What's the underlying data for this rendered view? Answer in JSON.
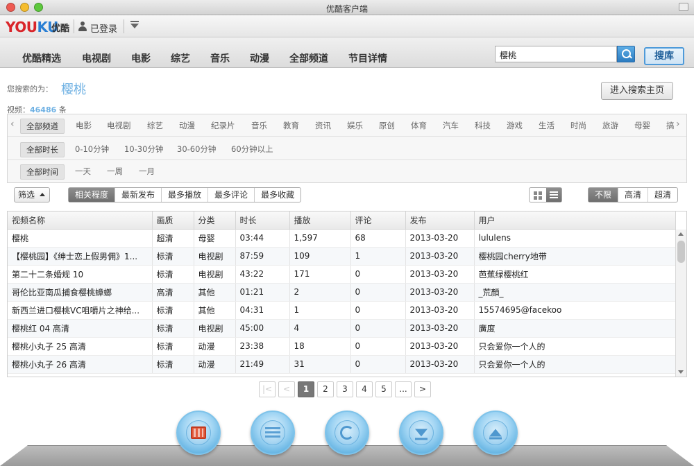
{
  "window": {
    "title": "优酷客户端"
  },
  "header": {
    "logo_you": "YOU",
    "logo_ku": "KU",
    "logo_cn": "优酷",
    "login_text": "已登录"
  },
  "nav": {
    "items": [
      "优酷精选",
      "电视剧",
      "电影",
      "综艺",
      "音乐",
      "动漫",
      "全部频道",
      "节目详情"
    ]
  },
  "search": {
    "value": "樱桃",
    "button_label": "搜库"
  },
  "results": {
    "label": "您搜索的为：",
    "term": "樱桃",
    "count_prefix": "视频：",
    "count": "46486",
    "count_suffix": "条",
    "home_button": "进入搜索主页"
  },
  "filters": {
    "channels": [
      "全部频道",
      "电影",
      "电视剧",
      "综艺",
      "动漫",
      "纪录片",
      "音乐",
      "教育",
      "资讯",
      "娱乐",
      "原创",
      "体育",
      "汽车",
      "科技",
      "游戏",
      "生活",
      "时尚",
      "旅游",
      "母婴",
      "搞"
    ],
    "durations": [
      "全部时长",
      "0-10分钟",
      "10-30分钟",
      "30-60分钟",
      "60分钟以上"
    ],
    "times": [
      "全部时间",
      "一天",
      "一周",
      "一月"
    ]
  },
  "toolbar": {
    "filter_label": "筛选",
    "sort_options": [
      "相关程度",
      "最新发布",
      "最多播放",
      "最多评论",
      "最多收藏"
    ],
    "quality_options": [
      "不限",
      "高清",
      "超清"
    ]
  },
  "table": {
    "columns": [
      "视频名称",
      "画质",
      "分类",
      "时长",
      "播放",
      "评论",
      "发布",
      "用户"
    ],
    "rows": [
      [
        "樱桃",
        "超清",
        "母婴",
        "03:44",
        "1,597",
        "68",
        "2013-03-20",
        "lululens"
      ],
      [
        "【樱桃园】《绅士恋上假男佣》1...",
        "标清",
        "电视剧",
        "87:59",
        "109",
        "1",
        "2013-03-20",
        "樱桃园cherry地带"
      ],
      [
        "第二十二条婚规 10",
        "标清",
        "电视剧",
        "43:22",
        "171",
        "0",
        "2013-03-20",
        "芭蕉绿樱桃红"
      ],
      [
        "哥伦比亚南瓜捕食樱桃蟑螂",
        "高清",
        "其他",
        "01:21",
        "2",
        "0",
        "2013-03-20",
        "_荒顏_"
      ],
      [
        "新西兰进口樱桃VC咀嚼片之神给...",
        "标清",
        "其他",
        "04:31",
        "1",
        "0",
        "2013-03-20",
        "15574695@facekoo"
      ],
      [
        "樱桃红 04 高清",
        "标清",
        "电视剧",
        "45:00",
        "4",
        "0",
        "2013-03-20",
        "廣度"
      ],
      [
        "樱桃小丸子 25 高清",
        "标清",
        "动漫",
        "23:38",
        "18",
        "0",
        "2013-03-20",
        "只会爱你一个人的"
      ],
      [
        "樱桃小丸子 26 高清",
        "标清",
        "动漫",
        "21:49",
        "31",
        "0",
        "2013-03-20",
        "只会爱你一个人的"
      ]
    ]
  },
  "pager": {
    "first": "|<",
    "prev": "<",
    "pages": [
      "1",
      "2",
      "3",
      "4",
      "5",
      "..."
    ],
    "next": ">"
  },
  "dock": {
    "icons": [
      "film-icon",
      "playlist-icon",
      "refresh-icon",
      "download-icon",
      "upload-icon"
    ]
  },
  "colors": {
    "accent": "#6fb1e3",
    "logo_red": "#d9252a",
    "logo_blue": "#2a7fd4"
  }
}
